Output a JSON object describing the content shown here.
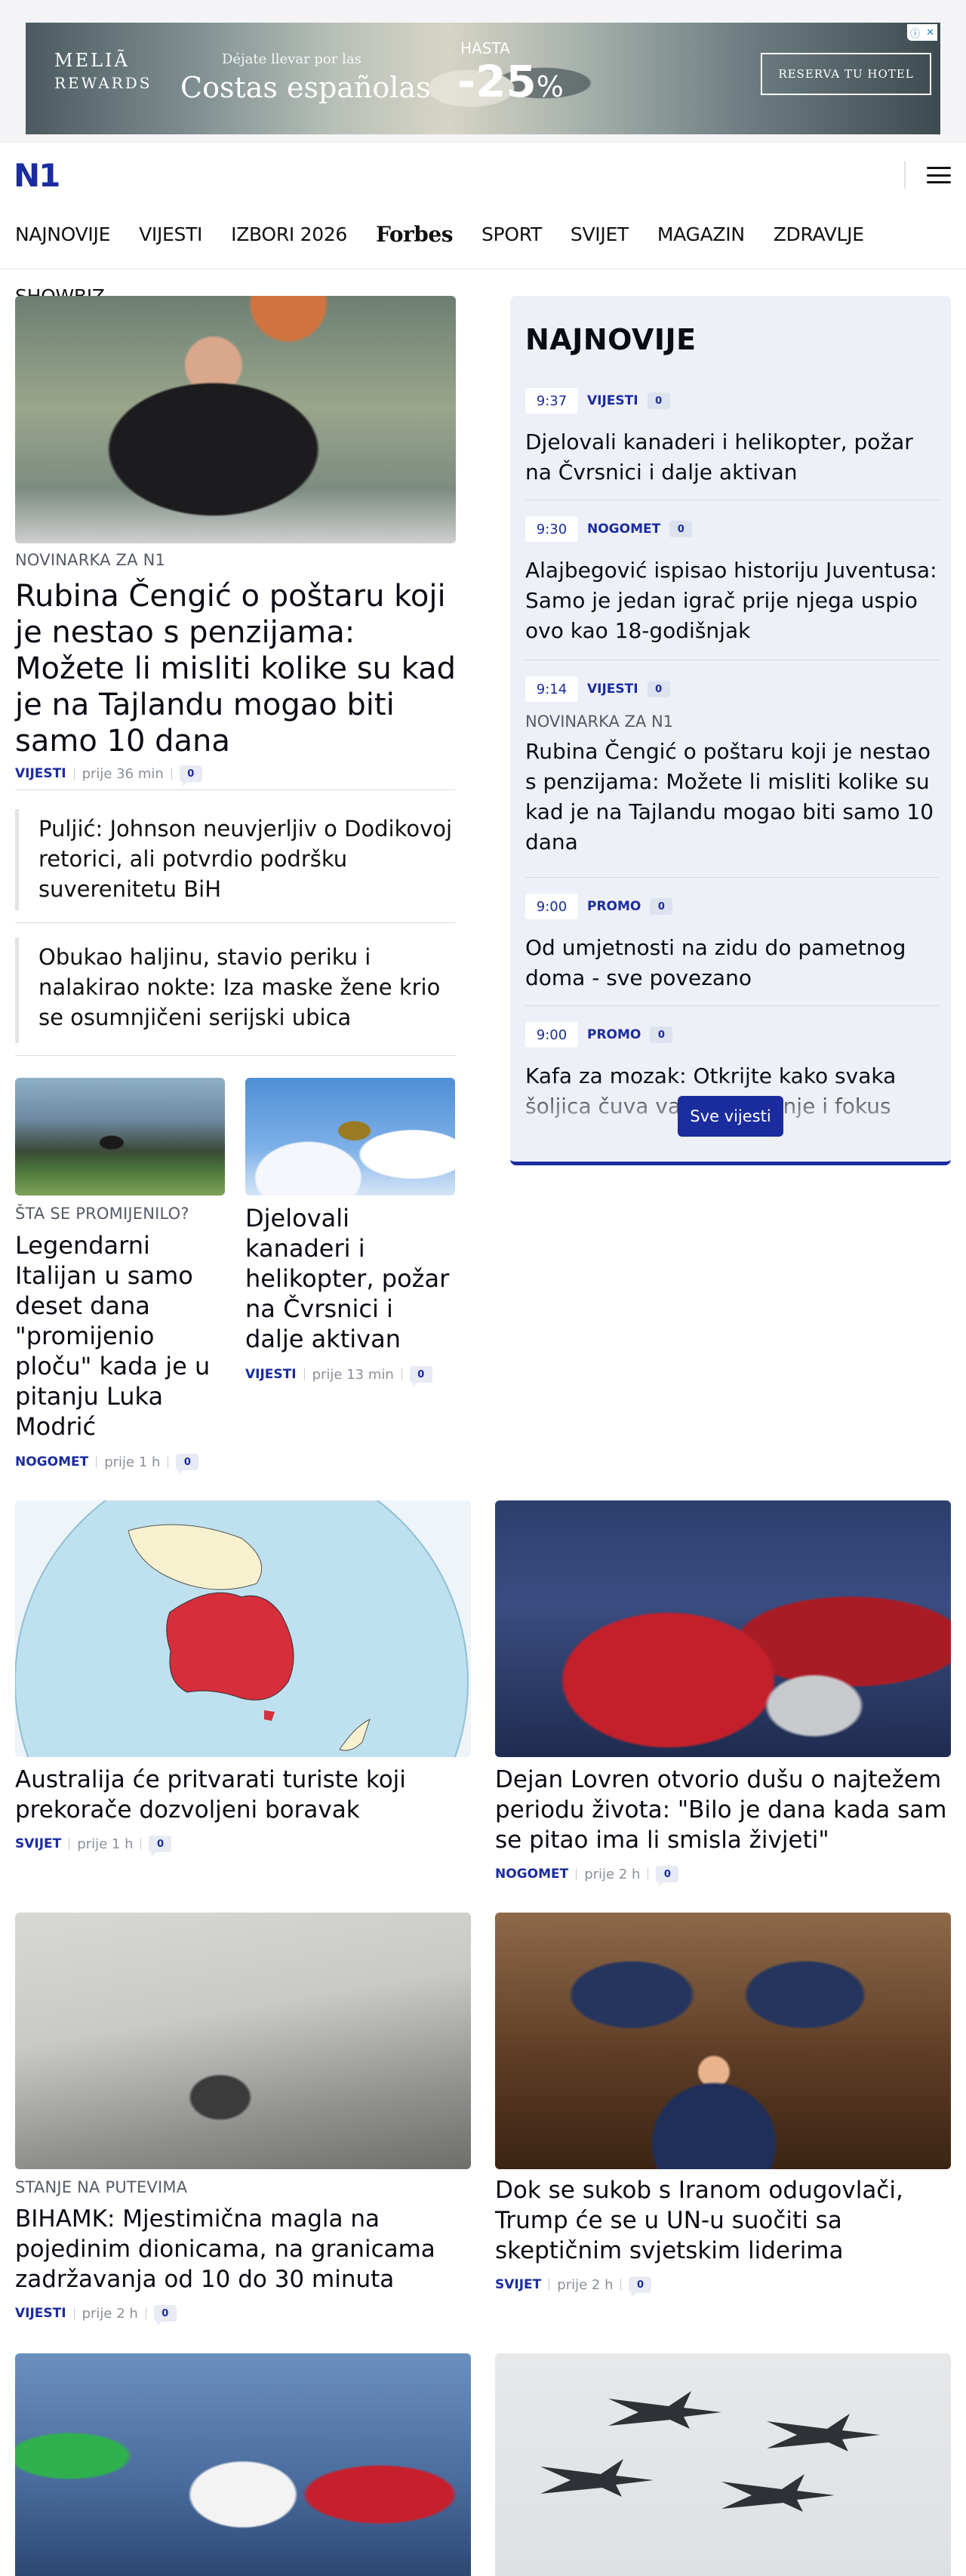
{
  "ad": {
    "brand_line1": "MELIÃ",
    "brand_line2": "REWARDS",
    "tagline1": "Déjate llevar por las",
    "tagline2": "Costas españolas",
    "hasta": "HASTA",
    "discount": "-25",
    "percent": "%",
    "cta": "RESERVA TU HOTEL"
  },
  "header": {
    "logo": "N1"
  },
  "nav": {
    "items": [
      "NAJNOVIJE",
      "VIJESTI",
      "IZBORI 2026",
      "Forbes",
      "SPORT",
      "SVIJET",
      "MAGAZIN",
      "ZDRAVLJE"
    ],
    "second_row": "SHOWBIZ"
  },
  "lead": {
    "kicker": "NOVINARKA ZA N1",
    "title": "Rubina Čengić o poštaru koji je nestao s penzijama: Možete li misliti kolike su kad je na Tajlandu mogao biti samo 10 dana",
    "category": "VIJESTI",
    "time": "prije 36 min",
    "comments": "0"
  },
  "related": [
    "Puljić: Johnson neuvjerljiv o Dodikovoj retorici, ali potvrdio podršku suverenitetu BiH",
    "Obukao haljinu, stavio periku i nalakirao nokte: Iza maske žene krio se osumnjičeni serijski ubica"
  ],
  "small_cards": [
    {
      "kicker": "ŠTA SE PROMIJENILO?",
      "title": "Legendarni Italijan u samo deset dana \"promijenio ploču\" kada je u pitanju Luka Modrić",
      "category": "NOGOMET",
      "time": "prije 1 h",
      "comments": "0"
    },
    {
      "kicker": "",
      "title": "Djelovali kanaderi i helikopter, požar na Čvrsnici i dalje aktivan",
      "category": "VIJESTI",
      "time": "prije 13 min",
      "comments": "0"
    }
  ],
  "sidebar": {
    "title": "NAJNOVIJE",
    "items": [
      {
        "time": "9:37",
        "category": "VIJESTI",
        "comments": "0",
        "kicker": "",
        "title": "Djelovali kanaderi i helikopter, požar na Čvrsnici i dalje aktivan"
      },
      {
        "time": "9:30",
        "category": "NOGOMET",
        "comments": "0",
        "kicker": "",
        "title": "Alajbegović ispisao historiju Juventusa: Samo je jedan igrač prije njega uspio ovo kao 18-godišnjak"
      },
      {
        "time": "9:14",
        "category": "VIJESTI",
        "comments": "0",
        "kicker": "NOVINARKA ZA N1",
        "title": "Rubina Čengić o poštaru koji je nestao s penzijama: Možete li misliti kolike su kad je na Tajlandu mogao biti samo 10 dana"
      },
      {
        "time": "9:00",
        "category": "PROMO",
        "comments": "0",
        "kicker": "",
        "title": "Od umjetnosti na zidu do pametnog doma - sve povezano"
      },
      {
        "time": "9:00",
        "category": "PROMO",
        "comments": "0",
        "kicker": "",
        "title": "Kafa za mozak: Otkrijte kako svaka šoljica čuva vaše pamćenje i fokus"
      }
    ],
    "button": "Sve vijesti"
  },
  "grid": [
    {
      "kicker": "",
      "title": "Australija će pritvarati turiste koji prekorače dozvoljeni boravak",
      "category": "SVIJET",
      "time": "prije 1 h",
      "comments": "0"
    },
    {
      "kicker": "",
      "title": "Dejan Lovren otvorio dušu o najtežem periodu života: \"Bilo je dana kada sam se pitao ima li smisla živjeti\"",
      "category": "NOGOMET",
      "time": "prije 2 h",
      "comments": "0"
    },
    {
      "kicker": "STANJE NA PUTEVIMA",
      "title": "BIHAMK: Mjestimična magla na pojedinim dionicama, na granicama zadržavanja od 10 do 30 minuta",
      "category": "VIJESTI",
      "time": "prije 2 h",
      "comments": "0"
    },
    {
      "kicker": "",
      "title": "Dok se sukob s Iranom odugovlači, Trump će se u UN-u suočiti sa skeptičnim svjetskim liderima",
      "category": "SVIJET",
      "time": "prije 2 h",
      "comments": "0"
    }
  ]
}
